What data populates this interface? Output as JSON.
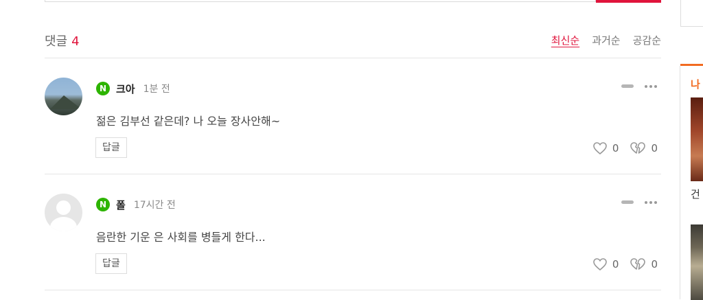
{
  "header": {
    "title": "댓글",
    "count": "4"
  },
  "sort_tabs": [
    {
      "label": "최신순",
      "active": true
    },
    {
      "label": "과거순",
      "active": false
    },
    {
      "label": "공감순",
      "active": false
    }
  ],
  "comments": [
    {
      "badge": "N",
      "author": "크아",
      "time": "1분 전",
      "text": "젊은 김부선 같은데? 나 오늘 장사안해~",
      "reply_label": "답글",
      "likes": "0",
      "dislikes": "0",
      "avatar": "profile-photo"
    },
    {
      "badge": "N",
      "author": "폴",
      "time": "17시간 전",
      "text": "음란한 기운 은 사회를 병들게 한다...",
      "reply_label": "답글",
      "likes": "0",
      "dislikes": "0",
      "avatar": "default-avatar"
    }
  ],
  "sidebar": {
    "heading": "나",
    "caption": "건"
  },
  "colors": {
    "accent": "#e0143c",
    "naver_green": "#2db400",
    "sidebar_accent": "#f26b21"
  },
  "icons": [
    "minus-icon",
    "more-icon",
    "heart-icon",
    "broken-heart-icon"
  ]
}
